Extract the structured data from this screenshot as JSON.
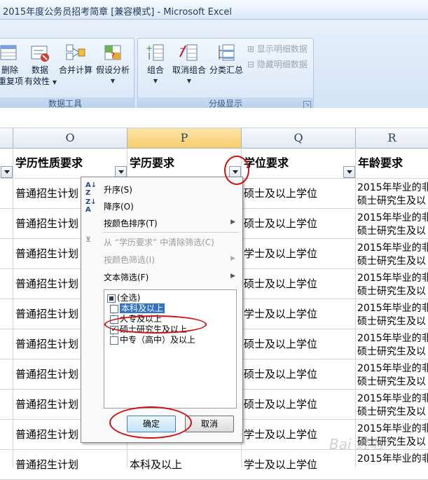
{
  "window": {
    "title": "2015年度公务员招考简章  [兼容模式] - Microsoft Excel"
  },
  "ribbon": {
    "groups": [
      {
        "label": "数据工具",
        "buttons": [
          {
            "label1": "删除",
            "label2": "重复项"
          },
          {
            "label1": "数据",
            "label2": "有效性"
          },
          {
            "label1": "合并计算",
            "label2": ""
          },
          {
            "label1": "假设分析",
            "label2": ""
          }
        ]
      },
      {
        "label": "分级显示",
        "buttons": [
          {
            "label1": "组合",
            "label2": ""
          },
          {
            "label1": "取消组合",
            "label2": ""
          },
          {
            "label1": "分类汇总",
            "label2": ""
          }
        ],
        "small": [
          "显示明细数据",
          "隐藏明细数据"
        ]
      }
    ]
  },
  "sheet": {
    "columns": [
      "O",
      "P",
      "Q",
      "R"
    ],
    "headers": [
      "学历性质要求",
      "学历要求",
      "学位要求",
      "年龄要求"
    ],
    "rows": [
      {
        "o": "普通招生计划",
        "q": "硕士及以上学位",
        "r1": "2015年毕业的非",
        "r2": "硕士研究生及以"
      },
      {
        "o": "普通招生计划",
        "q": "硕士及以上学位",
        "r1": "2015年毕业的非",
        "r2": "硕士研究生及以"
      },
      {
        "o": "普通招生计划",
        "q": "学士及以上学位",
        "r1": "2015年毕业的非",
        "r2": "硕士研究生及以"
      },
      {
        "o": "普通招生计划",
        "q": "硕士及以上学位",
        "r1": "2015年毕业的非",
        "r2": "硕士研究生及以"
      },
      {
        "o": "普通招生计划",
        "q": "学士及以上学位",
        "r1": "2015年毕业的非",
        "r2": "硕士研究生及以"
      },
      {
        "o": "普通招生计划",
        "q": "硕士及以上学位",
        "r1": "2015年毕业的非",
        "r2": "硕士研究生及以"
      },
      {
        "o": "普通招生计划",
        "q": "硕士及以上学位",
        "r1": "2015年毕业的非",
        "r2": "硕士研究生及以"
      },
      {
        "o": "普通招生计划",
        "q": "硕士及以上学位",
        "r1": "2015年毕业的非",
        "r2": "硕士研究生及以"
      },
      {
        "o": "普通招生计划",
        "q": "学士及以上学位",
        "r1": "2015年毕业的非",
        "r2": "硕士研究生及以"
      }
    ],
    "last_row": {
      "o": "普通招生计划",
      "p": "本科及以上",
      "q": "学士及以上学位",
      "r1": "2015年毕业的非"
    }
  },
  "filter_menu": {
    "sort_asc": "升序(S)",
    "sort_desc": "降序(O)",
    "sort_color": "按颜色排序(T)",
    "clear": "从 “学历要求” 中清除筛选(C)",
    "filter_color": "按颜色筛选(I)",
    "text_filter": "文本筛选(F)",
    "list": [
      {
        "label": "(全选)",
        "state": "partial"
      },
      {
        "label": "本科及以上",
        "state": "unchecked"
      },
      {
        "label": "大专及以上",
        "state": "unchecked"
      },
      {
        "label": "硕士研究生及以上",
        "state": "checked"
      },
      {
        "label": "中专（高中）及以上",
        "state": "unchecked"
      }
    ],
    "ok": "确定",
    "cancel": "取消"
  },
  "watermark": "Bai 经验"
}
